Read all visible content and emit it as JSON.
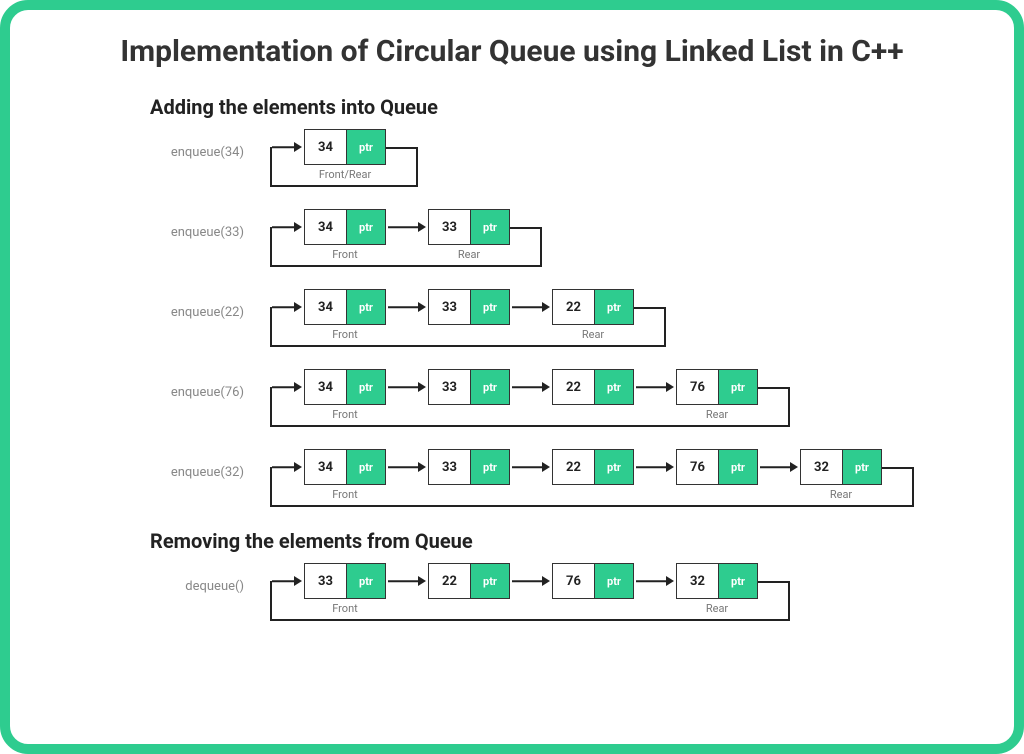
{
  "title": "Implementation of Circular Queue using Linked List in C++",
  "section_add": "Adding the elements into Queue",
  "section_remove": "Removing the elements from Queue",
  "ptr_label": "ptr",
  "labels": {
    "front": "Front",
    "rear": "Rear",
    "front_rear": "Front/Rear"
  },
  "ops": {
    "add": [
      {
        "op": "enqueue(34)",
        "nodes": [
          34
        ],
        "label_mode": "single"
      },
      {
        "op": "enqueue(33)",
        "nodes": [
          34,
          33
        ]
      },
      {
        "op": "enqueue(22)",
        "nodes": [
          34,
          33,
          22
        ]
      },
      {
        "op": "enqueue(76)",
        "nodes": [
          34,
          33,
          22,
          76
        ]
      },
      {
        "op": "enqueue(32)",
        "nodes": [
          34,
          33,
          22,
          76,
          32
        ]
      }
    ],
    "remove": [
      {
        "op": "dequeue()",
        "nodes": [
          33,
          22,
          76,
          32
        ]
      }
    ]
  }
}
